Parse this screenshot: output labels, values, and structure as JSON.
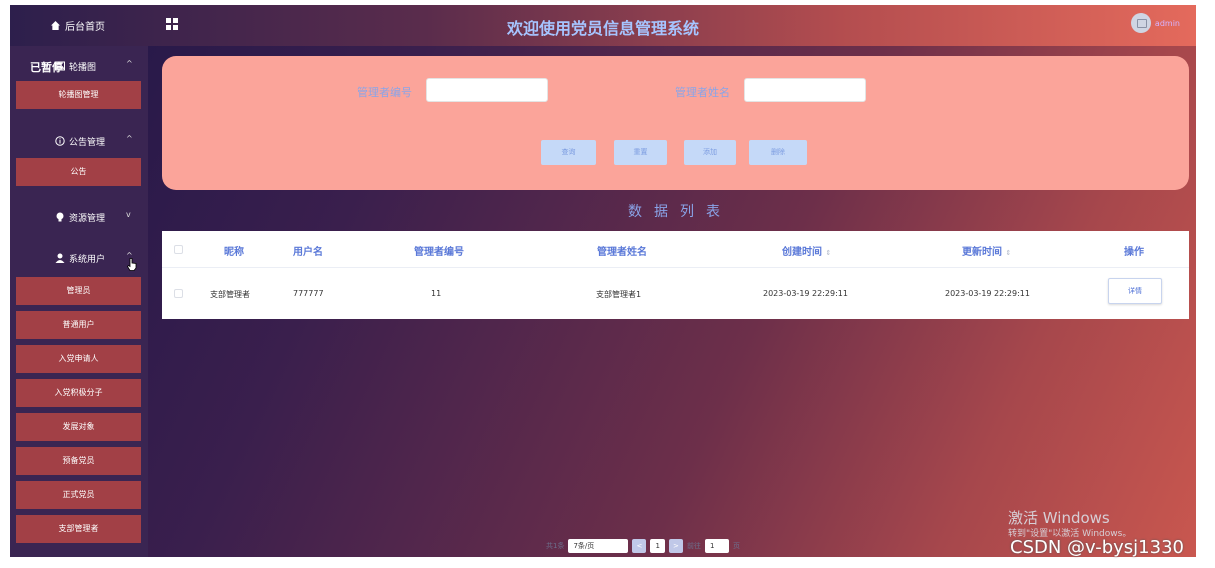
{
  "header": {
    "home_label": "后台首页",
    "title": "欢迎使用党员信息管理系统",
    "username": "admin"
  },
  "overlay": {
    "paused": "已暂停"
  },
  "sidebar": {
    "menus": [
      {
        "label": "轮播图",
        "chev": "^",
        "icon": "image-icon"
      },
      {
        "label": "公告管理",
        "chev": "^",
        "icon": "info-circle-icon"
      },
      {
        "label": "资源管理",
        "chev": "v",
        "icon": "bulb-icon"
      },
      {
        "label": "系统用户",
        "chev": "^",
        "icon": "user-icon"
      }
    ],
    "items": {
      "carousel": "轮播图管理",
      "notice": "公告",
      "admin": "管理员",
      "normal_user": "普通用户",
      "applicant": "入党申请人",
      "activist": "入党积极分子",
      "development": "发展对象",
      "probationary": "预备党员",
      "formal": "正式党员",
      "branch_admin": "支部管理者"
    }
  },
  "search": {
    "admin_no_label": "管理者编号",
    "admin_name_label": "管理者姓名",
    "admin_no_value": "",
    "admin_name_value": "",
    "buttons": {
      "query": "查询",
      "reset": "重置",
      "add": "添加",
      "delete": "删除"
    }
  },
  "list_title": "数据列表",
  "table": {
    "headers": {
      "nickname": "昵称",
      "username": "用户名",
      "admin_no": "管理者编号",
      "admin_name": "管理者姓名",
      "created": "创建时间",
      "updated": "更新时间",
      "action": "操作"
    },
    "sort_symbol": "⇕",
    "rows": [
      {
        "nickname": "支部管理者",
        "username": "777777",
        "admin_no": "11",
        "admin_name": "支部管理者1",
        "created": "2023-03-19 22:29:11",
        "updated": "2023-03-19 22:29:11",
        "action": "详情"
      }
    ]
  },
  "pagination": {
    "total": "共1条",
    "page_size": "7条/页",
    "prev": "<",
    "current": "1",
    "next": ">",
    "goto_prefix": "前往",
    "goto_value": "1",
    "goto_suffix": "页"
  },
  "watermark": {
    "win_title": "激活 Windows",
    "win_sub": "转到\"设置\"以激活 Windows。",
    "csdn": "CSDN @v-bysj1330"
  },
  "colors": {
    "accent_blue": "#8aa4e8",
    "panel_pink": "#fba49a",
    "menu_item_red": "#a24046"
  }
}
